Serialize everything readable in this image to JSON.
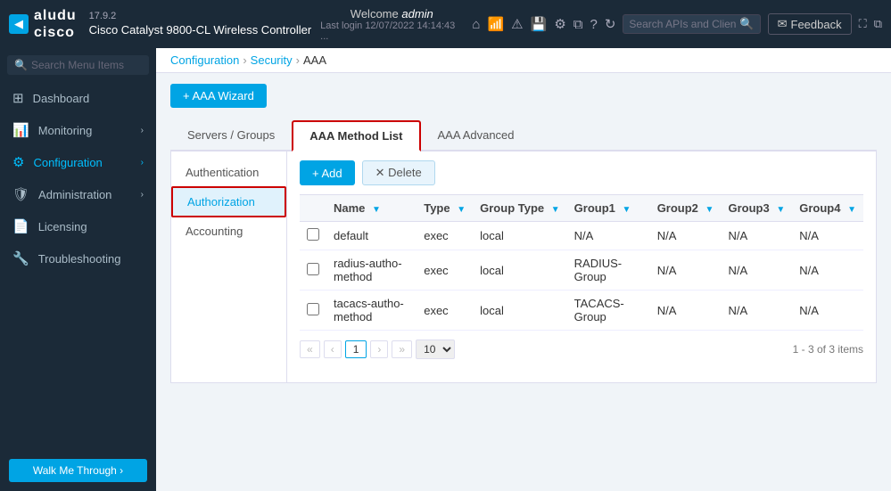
{
  "app": {
    "version": "17.9.2",
    "title": "Cisco Catalyst 9800-CL Wireless Controller",
    "welcome": "Welcome",
    "username": "admin",
    "last_login": "Last login 12/07/2022 14:14:43 ..."
  },
  "header": {
    "search_placeholder": "Search APIs and Clients",
    "feedback_label": "Feedback",
    "back_icon": "◀"
  },
  "sidebar": {
    "search_placeholder": "Search Menu Items",
    "items": [
      {
        "id": "dashboard",
        "label": "Dashboard",
        "icon": "⊞",
        "has_chevron": false
      },
      {
        "id": "monitoring",
        "label": "Monitoring",
        "icon": "📊",
        "has_chevron": true
      },
      {
        "id": "configuration",
        "label": "Configuration",
        "icon": "⚙",
        "has_chevron": true,
        "active": true
      },
      {
        "id": "administration",
        "label": "Administration",
        "icon": "🛡",
        "has_chevron": true
      },
      {
        "id": "licensing",
        "label": "Licensing",
        "icon": "📄",
        "has_chevron": false
      },
      {
        "id": "troubleshooting",
        "label": "Troubleshooting",
        "icon": "🔧",
        "has_chevron": false
      }
    ],
    "walk_me_through": "Walk Me Through ›"
  },
  "breadcrumb": {
    "items": [
      "Configuration",
      "Security",
      "AAA"
    ],
    "separators": [
      "›",
      "›"
    ]
  },
  "wizard_btn": "+ AAA Wizard",
  "tabs": [
    {
      "id": "servers-groups",
      "label": "Servers / Groups"
    },
    {
      "id": "method-list",
      "label": "AAA Method List",
      "active": true
    },
    {
      "id": "advanced",
      "label": "AAA Advanced"
    }
  ],
  "sub_menu": [
    {
      "id": "authentication",
      "label": "Authentication"
    },
    {
      "id": "authorization",
      "label": "Authorization",
      "active": true
    },
    {
      "id": "accounting",
      "label": "Accounting"
    }
  ],
  "actions": {
    "add_label": "+ Add",
    "delete_label": "✕ Delete"
  },
  "table": {
    "columns": [
      {
        "id": "select",
        "label": ""
      },
      {
        "id": "name",
        "label": "Name",
        "filterable": true
      },
      {
        "id": "type",
        "label": "Type",
        "filterable": true
      },
      {
        "id": "group_type",
        "label": "Group Type",
        "filterable": true
      },
      {
        "id": "group1",
        "label": "Group1",
        "filterable": true
      },
      {
        "id": "group2",
        "label": "Group2",
        "filterable": true
      },
      {
        "id": "group3",
        "label": "Group3",
        "filterable": true
      },
      {
        "id": "group4",
        "label": "Group4",
        "filterable": true
      }
    ],
    "rows": [
      {
        "name": "default",
        "type": "exec",
        "group_type": "local",
        "group1": "N/A",
        "group2": "N/A",
        "group3": "N/A",
        "group4": "N/A"
      },
      {
        "name": "radius-autho-method",
        "type": "exec",
        "group_type": "local",
        "group1": "RADIUS-Group",
        "group2": "N/A",
        "group3": "N/A",
        "group4": "N/A"
      },
      {
        "name": "tacacs-autho-method",
        "type": "exec",
        "group_type": "local",
        "group1": "TACACS-Group",
        "group2": "N/A",
        "group3": "N/A",
        "group4": "N/A"
      }
    ]
  },
  "pagination": {
    "current_page": "1",
    "page_size": "10",
    "items_count": "1 - 3 of 3 items",
    "first_icon": "«",
    "prev_icon": "‹",
    "next_icon": "›",
    "last_icon": "»"
  },
  "colors": {
    "accent": "#00a4e4",
    "active_border": "#cc0000",
    "sidebar_bg": "#1b2a38",
    "sidebar_active": "#00bfff"
  }
}
